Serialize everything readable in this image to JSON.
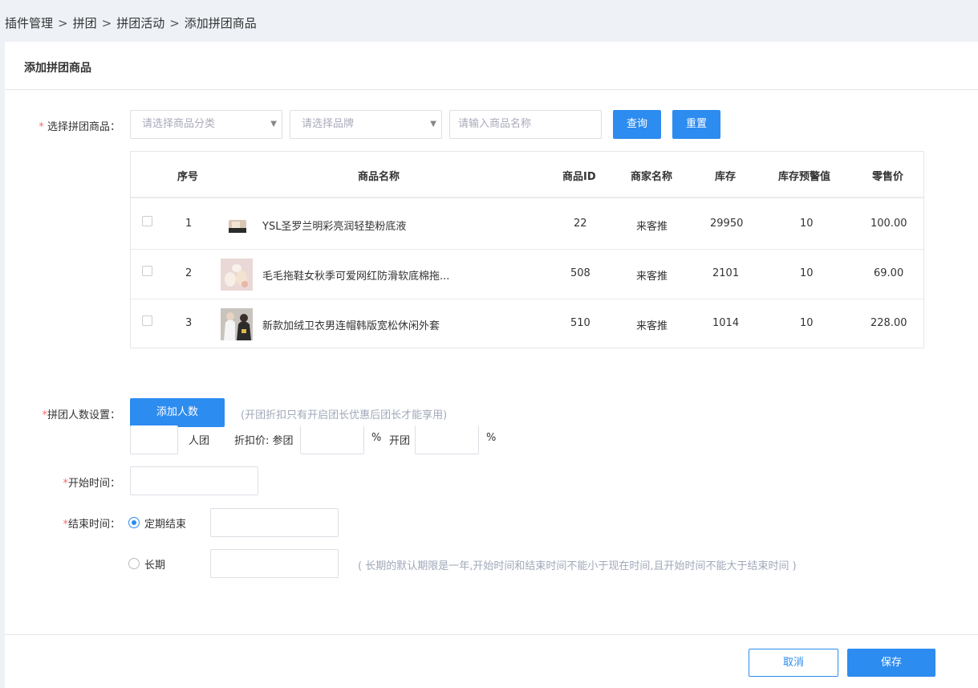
{
  "breadcrumb": [
    "插件管理",
    "拼团",
    "拼团活动",
    "添加拼团商品"
  ],
  "breadcrumb_sep": ">",
  "panel_title": "添加拼团商品",
  "select_goods": {
    "required_mark": "*",
    "label": "选择拼团商品：",
    "category_placeholder": "请选择商品分类",
    "brand_placeholder": "请选择品牌",
    "name_placeholder": "请输入商品名称",
    "query_button": "查询",
    "reset_button": "重置"
  },
  "table": {
    "headers": [
      "序号",
      "商品名称",
      "商品ID",
      "商家名称",
      "库存",
      "库存预警值",
      "零售价"
    ],
    "rows": [
      {
        "index": "1",
        "name": "YSL圣罗兰明彩亮润轻垫粉底液",
        "id": "22",
        "merchant": "来客推",
        "stock": "29950",
        "warning": "10",
        "price": "100.00",
        "thumb": "cosmetic-product-image"
      },
      {
        "index": "2",
        "name": "毛毛拖鞋女秋季可爱网红防滑软底棉拖...",
        "id": "508",
        "merchant": "来客推",
        "stock": "2101",
        "warning": "10",
        "price": "69.00",
        "thumb": "slippers-product-image"
      },
      {
        "index": "3",
        "name": "新款加绒卫衣男连帽韩版宽松休闲外套",
        "id": "510",
        "merchant": "来客推",
        "stock": "1014",
        "warning": "10",
        "price": "228.00",
        "thumb": "hoodie-product-image"
      }
    ]
  },
  "group_size": {
    "required_mark": "*",
    "label": "拼团人数设置：",
    "add_button": "添加人数",
    "hint": "(开团折扣只有开启团长优惠后团长才能享用)",
    "unit": "人团",
    "discount_label": "折扣价: 参团",
    "percent": "%",
    "open_label": "开团"
  },
  "start_time": {
    "required_mark": "*",
    "label": "开始时间："
  },
  "end_time": {
    "required_mark": "*",
    "label": "结束时间：",
    "option_fixed": "定期结束",
    "option_long": "长期",
    "selected": "定期结束",
    "hint": "( 长期的默认期限是一年,开始时间和结束时间不能小于现在时间,且开始时间不能大于结束时间 )"
  },
  "footer": {
    "cancel_button": "取消",
    "save_button": "保存"
  },
  "colors": {
    "primary": "#2d8cf0",
    "required": "#f56c6c",
    "hint": "#a0a8b8",
    "background": "#eef1f6"
  }
}
